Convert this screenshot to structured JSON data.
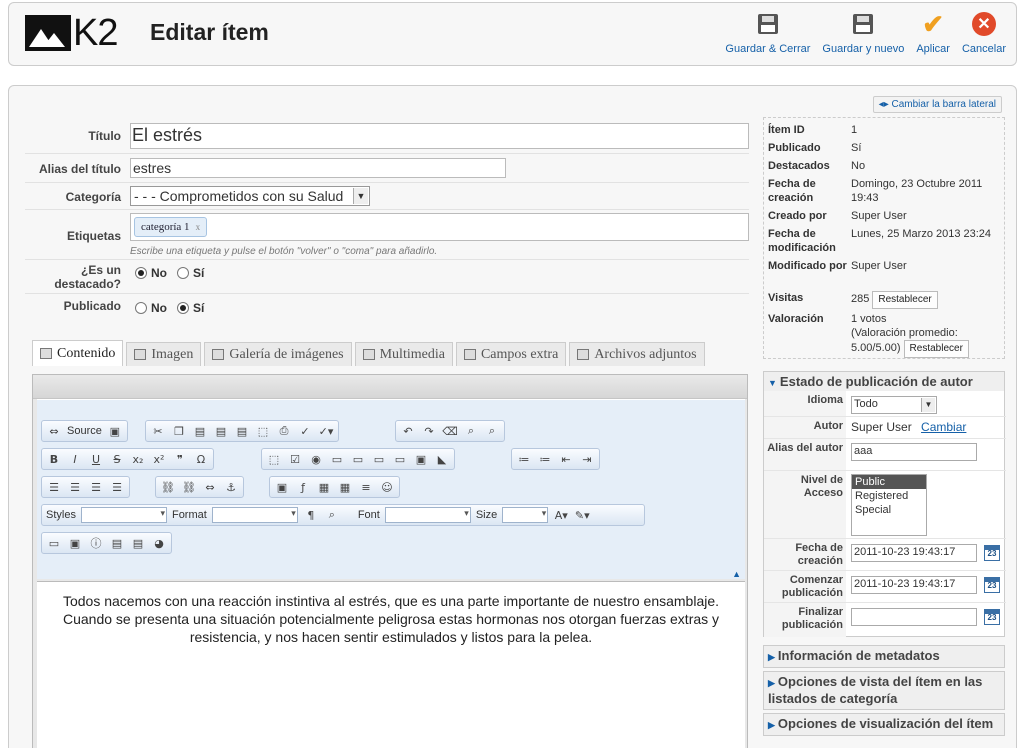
{
  "header": {
    "logo_text": "K2",
    "title": "Editar ítem",
    "buttons": {
      "save_close": "Guardar & Cerrar",
      "save_new": "Guardar y nuevo",
      "apply": "Aplicar",
      "cancel": "Cancelar"
    }
  },
  "sidebar_toggle": "Cambiar la barra lateral",
  "form": {
    "title_label": "Título",
    "title_value": "El estrés",
    "alias_label": "Alias del título",
    "alias_value": "estres",
    "category_label": "Categoría",
    "category_value": "- - - Comprometidos con su Salud",
    "tags_label": "Etiquetas",
    "tag_chip": "categoría 1",
    "tag_remove": "x",
    "tags_help": "Escribe una etiqueta y pulse el botón \"volver\" o \"coma\" para añadirlo.",
    "featured_label": "¿Es un destacado?",
    "featured_no": "No",
    "featured_yes": "Sí",
    "published_label": "Publicado",
    "published_no": "No",
    "published_yes": "Sí"
  },
  "tabs": [
    {
      "label": "Contenido",
      "active": true
    },
    {
      "label": "Imagen"
    },
    {
      "label": "Galería de imágenes"
    },
    {
      "label": "Multimedia"
    },
    {
      "label": "Campos extra"
    },
    {
      "label": "Archivos adjuntos"
    }
  ],
  "editor": {
    "source_label": "Source",
    "styles_label": "Styles",
    "format_label": "Format",
    "font_label": "Font",
    "size_label": "Size",
    "content": "Todos nacemos con una reacción instintiva al estrés, que es una parte importante de nuestro ensamblaje. Cuando se presenta una situación potencialmente peligrosa estas hormonas nos otorgan fuerzas extras y resistencia, y nos hacen sentir estimulados y listos para la pelea."
  },
  "item_info": {
    "id_label": "Ítem ID",
    "id_value": "1",
    "published_label": "Publicado",
    "published_value": "Sí",
    "featured_label": "Destacados",
    "featured_value": "No",
    "created_label": "Fecha de creación",
    "created_value": "Domingo, 23 Octubre 2011 19:43",
    "created_by_label": "Creado por",
    "created_by_value": "Super User",
    "modified_label": "Fecha de modificación",
    "modified_value": "Lunes, 25 Marzo 2013 23:24",
    "modified_by_label": "Modificado por",
    "modified_by_value": "Super User",
    "hits_label": "Visitas",
    "hits_value": "285",
    "reset_label": "Restablecer",
    "rating_label": "Valoración",
    "rating_votes": "1 votos",
    "rating_avg": "(Valoración promedio: 5.00/5.00)",
    "rating_reset": "Restablecer"
  },
  "publishing": {
    "header": "Estado de publicación de autor",
    "language_label": "Idioma",
    "language_value": "Todo",
    "author_label": "Autor",
    "author_value": "Super User",
    "author_change": "Cambiar",
    "author_alias_label": "Alias del autor",
    "author_alias_value": "aaa",
    "access_label": "Nivel de Acceso",
    "access_options": [
      "Public",
      "Registered",
      "Special"
    ],
    "created_label": "Fecha de creación",
    "created_value": "2011-10-23 19:43:17",
    "publish_up_label": "Comenzar publicación",
    "publish_up_value": "2011-10-23 19:43:17",
    "publish_down_label": "Finalizar publicación",
    "publish_down_value": "",
    "calendar_day": "23"
  },
  "accordions": {
    "metadata": "Información de metadatos",
    "view_options": "Opciones de vista del ítem en las listados de categoría",
    "display_options": "Opciones de visualización del ítem"
  }
}
